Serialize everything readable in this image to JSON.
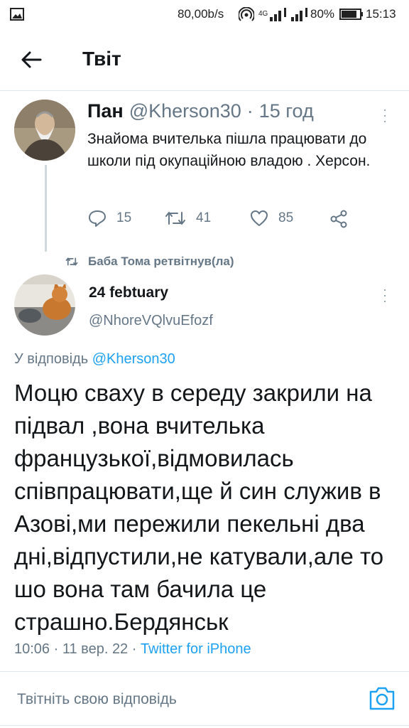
{
  "status_bar": {
    "speed": "80,00b/s",
    "network": "4G",
    "battery": "80%",
    "time": "15:13"
  },
  "header": {
    "title": "Твіт"
  },
  "parent_tweet": {
    "name": "Пан",
    "handle": "@Kherson30",
    "sep": "·",
    "time": "15 год",
    "text": "Знайома вчителька пішла працювати до школи під окупаційною владою . Херсон.",
    "reply_count": "15",
    "retweet_count": "41",
    "like_count": "85"
  },
  "retweet_label": "Баба Тома ретвітнув(ла)",
  "main_tweet": {
    "name": "24 febtuary",
    "handle": "@NhoreVQlvuEfozf",
    "reply_to_prefix": "У відповідь",
    "reply_to_handle": "@Kherson30",
    "text": "Моцю сваху в середу закрили на підвал ,вона вчителька французької,відмовилась співпрацювати,ще й син служив в Азові,ми пережили пекельні два дні,відпустили,не катували,але то шо вона там бачила це страшно.Бердянськ",
    "time": "10:06",
    "date": "11 вер. 22",
    "sep": "·",
    "source": "Twitter for iPhone"
  },
  "reply_box": {
    "placeholder": "Твітніть свою відповідь"
  },
  "colors": {
    "accent": "#1da1f2",
    "secondary_text": "#657786",
    "divider": "#e1e8ed"
  },
  "icons": [
    "image-icon",
    "hotspot-icon",
    "signal-icon",
    "battery-icon",
    "back-arrow-icon",
    "more-icon",
    "reply-icon",
    "retweet-icon",
    "like-icon",
    "share-icon",
    "camera-icon"
  ]
}
